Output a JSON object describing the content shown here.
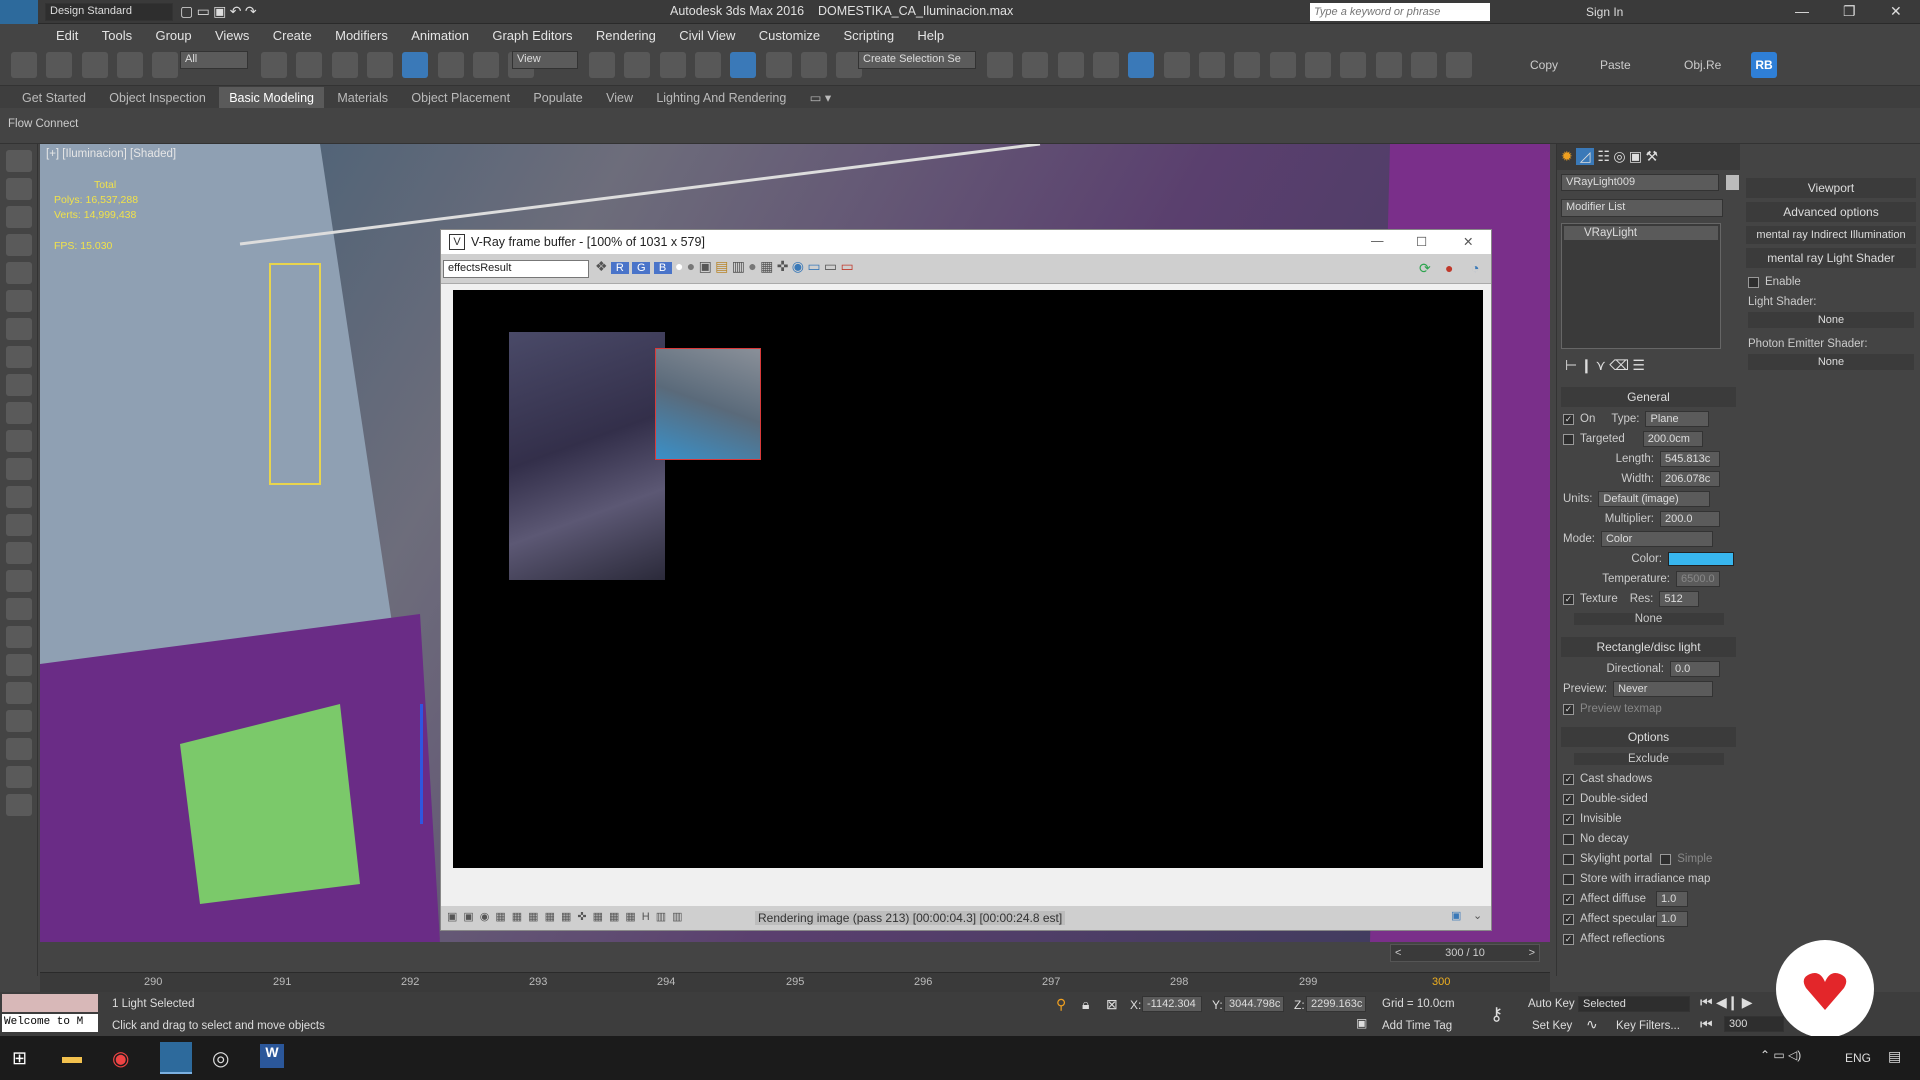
{
  "title": {
    "workspace": "Design Standard",
    "app": "Autodesk 3ds Max 2016",
    "file": "DOMESTIKA_CA_Iluminacion.max",
    "search_placeholder": "Type a keyword or phrase",
    "sign_in": "Sign In"
  },
  "menu": [
    "Edit",
    "Tools",
    "Group",
    "Views",
    "Create",
    "Modifiers",
    "Animation",
    "Graph Editors",
    "Rendering",
    "Civil View",
    "Customize",
    "Scripting",
    "Help"
  ],
  "toolbar": {
    "selection_filter": "All",
    "ref_coord": "View",
    "named_selection": "Create Selection Se",
    "copy": "Copy",
    "paste": "Paste",
    "objre": "Obj.Re",
    "rb": "RB"
  },
  "ribbon": {
    "tabs": [
      "Get Started",
      "Object Inspection",
      "Basic Modeling",
      "Materials",
      "Object Placement",
      "Populate",
      "View",
      "Lighting And Rendering"
    ],
    "active_index": 2,
    "sub": "Flow Connect"
  },
  "viewport": {
    "label": "[+] [Iluminacion] [Shaded]",
    "stats": {
      "total": "Total",
      "polys_label": "Polys:",
      "polys": "16,537,288",
      "verts_label": "Verts:",
      "verts": "14,999,438",
      "fps_label": "FPS:",
      "fps": "15.030"
    }
  },
  "vfb": {
    "title": "V-Ray frame buffer - [100% of 1031 x 579]",
    "channel": "effectsResult",
    "status": "Rendering image (pass 213) [00:00:04.3] [00:00:24.8 est]"
  },
  "cmd": {
    "object_name": "VRayLight009",
    "modifier_list": "Modifier List",
    "stack_item": "VRayLight",
    "general": {
      "header": "General",
      "on": "On",
      "type_label": "Type:",
      "type": "Plane",
      "targeted": "Targeted",
      "targeted_val": "200.0cm",
      "length_label": "Length:",
      "length": "545.813c",
      "width_label": "Width:",
      "width": "206.078c",
      "units_label": "Units:",
      "units": "Default (image)",
      "multiplier_label": "Multiplier:",
      "multiplier": "200.0",
      "mode_label": "Mode:",
      "mode": "Color",
      "color_label": "Color:",
      "color": "#38b6ee",
      "temperature_label": "Temperature:",
      "temperature": "6500.0",
      "texture": "Texture",
      "res_label": "Res:",
      "res": "512",
      "none": "None"
    },
    "rect": {
      "header": "Rectangle/disc light",
      "directional_label": "Directional:",
      "directional": "0.0",
      "preview_label": "Preview:",
      "preview": "Never",
      "preview_texmap": "Preview texmap"
    },
    "options": {
      "header": "Options",
      "exclude": "Exclude",
      "items": [
        "Cast shadows",
        "Double-sided",
        "Invisible",
        "No decay",
        "Skylight portal",
        "Store with irradiance map",
        "Affect diffuse",
        "Affect specular",
        "Affect reflections"
      ],
      "simple": "Simple",
      "affect_diffuse_val": "1.0",
      "affect_specular_val": "1.0"
    }
  },
  "right": {
    "viewport": "Viewport",
    "advanced": "Advanced options",
    "mr_indirect": "mental ray Indirect Illumination",
    "mr_light": "mental ray Light Shader",
    "enable": "Enable",
    "light_shader": "Light Shader:",
    "none1": "None",
    "photon": "Photon Emitter Shader:",
    "none2": "None"
  },
  "timeline": {
    "frame": "300 / 10",
    "ticks": [
      "290",
      "291",
      "292",
      "293",
      "294",
      "295",
      "296",
      "297",
      "298",
      "299",
      "300"
    ]
  },
  "status": {
    "welcome": "Welcome to M",
    "selected": "1 Light Selected",
    "hint": "Click and drag to select and move objects",
    "x_label": "X:",
    "x": "-1142.304",
    "y_label": "Y:",
    "y": "3044.798c",
    "z_label": "Z:",
    "z": "2299.163c",
    "grid": "Grid = 10.0cm",
    "add_time_tag": "Add Time Tag",
    "auto_key": "Auto Key",
    "set_key": "Set Key",
    "selected_dd": "Selected",
    "key_filters": "Key Filters...",
    "frame_field": "300"
  },
  "taskbar": {
    "lang": "ENG"
  }
}
